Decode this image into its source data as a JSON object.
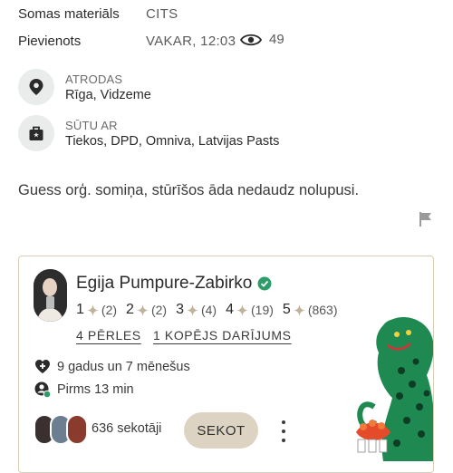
{
  "details": {
    "bag_material_label": "Somas materiāls",
    "bag_material_value": "CITS",
    "added_label": "Pievienots",
    "added_value": "VAKAR, 12:03",
    "views": "49"
  },
  "location": {
    "caption": "ATRODAS",
    "value": "Rīga, Vidzeme"
  },
  "shipping": {
    "caption": "SŪTU AR",
    "value": "Tiekos, DPD, Omniva, Latvijas Pasts"
  },
  "description": "Guess orģ. somiņa, stūrīšos āda nedaudz nolupusi.",
  "seller": {
    "name": "Egija Pumpure-Zabirko",
    "ratings": [
      {
        "level": "1",
        "count": "(2)"
      },
      {
        "level": "2",
        "count": "(2)"
      },
      {
        "level": "3",
        "count": "(4)"
      },
      {
        "level": "4",
        "count": "(19)"
      },
      {
        "level": "5",
        "count": "(863)"
      }
    ],
    "pearls_link": "4 PĒRLES",
    "deals_link": "1 KOPĒJS DARĪJUMS",
    "member_for": "9 gadus un 7 mēnešus",
    "last_seen": "Pirms 13 min",
    "followers": "636 sekotāji",
    "follow_button": "SEKOT"
  },
  "colors": {
    "accent_beige": "#dcd3c3",
    "card_border": "#d8cdb6",
    "verified_green": "#2e9b6a",
    "star_tan": "#bfb39b"
  }
}
